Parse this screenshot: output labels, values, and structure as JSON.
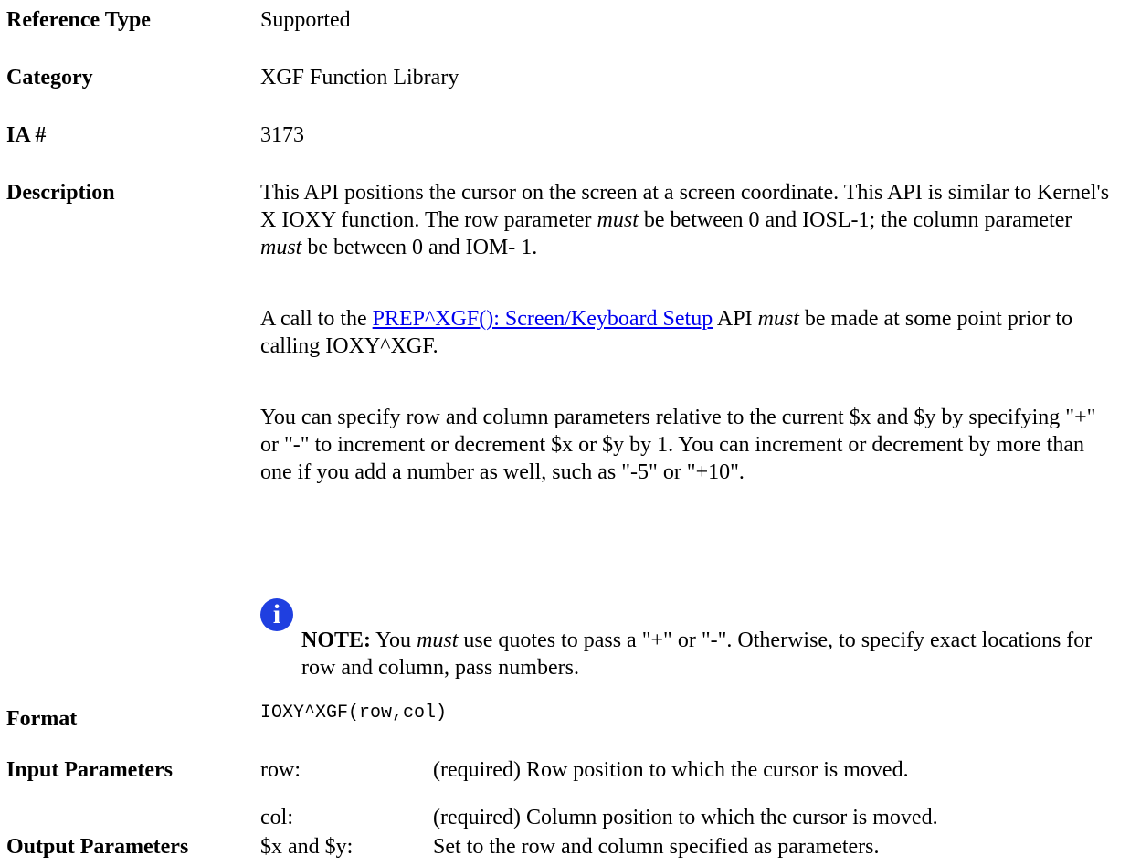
{
  "reference_type": {
    "label": "Reference Type",
    "value": "Supported"
  },
  "category": {
    "label": "Category",
    "value": "XGF Function Library"
  },
  "ia": {
    "label": "IA #",
    "value": "3173"
  },
  "description": {
    "label": "Description",
    "p1": {
      "a": "This API positions the cursor on the screen at a screen coordinate. This API is similar to Kernel's X IOXY function. The row parameter ",
      "em1": "must",
      "b": " be between 0 and IOSL-1; the column parameter ",
      "em2": "must",
      "c": " be between 0 and IOM- 1."
    },
    "p2": {
      "a": "A call to the ",
      "link": "PREP^XGF(): Screen/Keyboard Setup",
      "b": " API ",
      "em": "must",
      "c": " be made at some point prior to calling IOXY^XGF."
    },
    "p3": "You can specify row and column parameters relative to the current $x and $y by specifying \"+\" or \"-\" to increment or decrement $x or $y by 1. You can increment or decrement by more than one if you add a number as well, such as \"-5\" or \"+10\".",
    "note": {
      "icon": "info-icon",
      "label": "NOTE:",
      "a": " You ",
      "em": "must",
      "b": " use quotes to pass a \"+\" or \"-\". Otherwise, to specify exact locations for row and column, pass numbers."
    }
  },
  "format": {
    "label": "Format",
    "value": "IOXY^XGF(row,col)"
  },
  "input_parameters": {
    "label": "Input Parameters",
    "items": [
      {
        "name": "row:",
        "desc": "(required) Row position to which the cursor is moved."
      },
      {
        "name": "col:",
        "desc": "(required) Column position to which the cursor is moved."
      }
    ]
  },
  "output_parameters": {
    "label": "Output Parameters",
    "items": [
      {
        "name": "$x and $y:",
        "desc": "Set to the row and column specified as parameters."
      }
    ]
  }
}
